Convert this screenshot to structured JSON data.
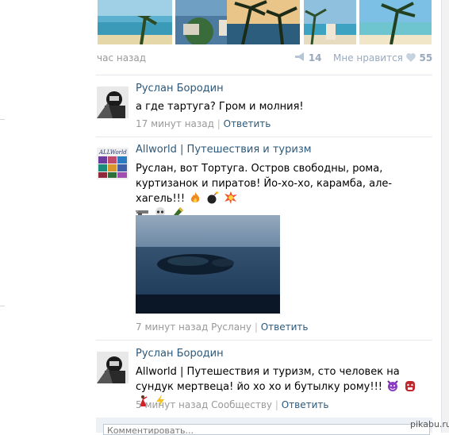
{
  "post": {
    "time": "час назад",
    "reposts": "14",
    "like_label": "Мне нравится",
    "likes": "55"
  },
  "comments": [
    {
      "author": "Руслан Бородин",
      "text": "а где тартуга? Гром и молния!",
      "time": "17 минут назад",
      "reply": "Ответить"
    },
    {
      "author": "Allworld | Путешествия и туризм",
      "avatar_text": "ALLWorld",
      "text": "Руслан, вот Тортуга. Остров свободны, рома, куртизанок и пиратов! Йо-хо-хо, карамба, але-хагель!!!",
      "time": "7 минут назад Руслану",
      "reply": "Ответить"
    },
    {
      "author": "Руслан Бородин",
      "text": "Allworld | Путешествия и туризм, сто человек на сундук мертвеца! йо хо хо и бутылку рому!!!",
      "time": "5 минут назад Сообществу",
      "reply": "Ответить"
    }
  ],
  "separator": "|",
  "comment_placeholder": "Комментировать...",
  "watermark": "pikabu.ru",
  "icons": {
    "repost": "megaphone-icon",
    "like": "heart-icon",
    "c2_emojis": [
      "fire-emoji",
      "bomb-emoji",
      "collision-emoji",
      "pistol-emoji",
      "skull-emoji",
      "champagne-emoji"
    ],
    "c3_emojis": [
      "smiling-imp-emoji",
      "ogre-emoji",
      "dancer-emoji",
      "lightning-emoji"
    ]
  },
  "colors": {
    "link": "#2b587a",
    "meta": "#999999",
    "stats": "#99a9bd"
  }
}
